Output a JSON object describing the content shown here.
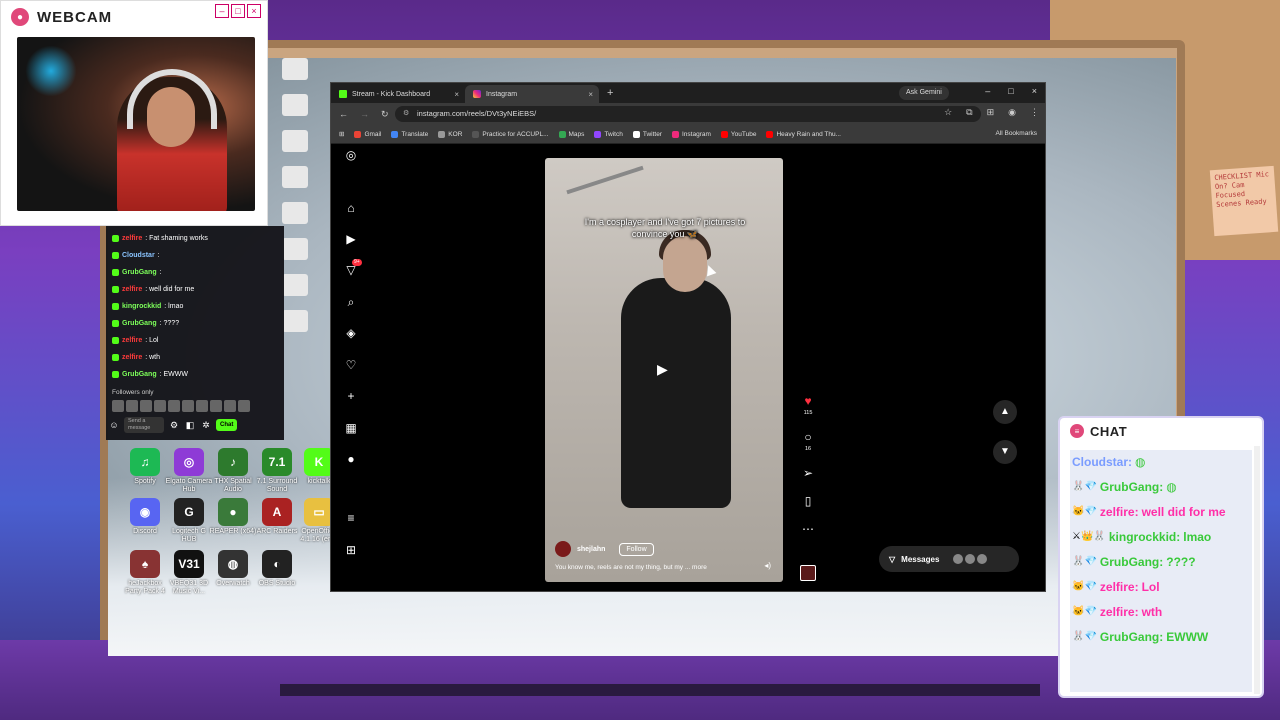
{
  "webcam": {
    "title": "WEBCAM"
  },
  "left_chat": {
    "messages": [
      {
        "user": "zelfire",
        "text": ": Fat shaming works",
        "color": "red"
      },
      {
        "user": "Cloudstar",
        "text": ":",
        "color": "blue"
      },
      {
        "user": "GrubGang",
        "text": ":",
        "color": "green"
      },
      {
        "user": "zelfire",
        "text": ": well did for me",
        "color": "red"
      },
      {
        "user": "kingrockkid",
        "text": ": lmao",
        "color": "green"
      },
      {
        "user": "GrubGang",
        "text": ": ????",
        "color": "green"
      },
      {
        "user": "zelfire",
        "text": ": Lol",
        "color": "red"
      },
      {
        "user": "zelfire",
        "text": ": wth",
        "color": "red"
      },
      {
        "user": "GrubGang",
        "text": ": EWWW",
        "color": "green"
      }
    ],
    "followers_only": "Followers only",
    "send_placeholder": "Send a message",
    "chat_button": "Chat"
  },
  "desktop_icons": [
    {
      "label": "Spotify",
      "color": "#1db954",
      "glyph": "♫"
    },
    {
      "label": "Elgato Camera Hub",
      "color": "#8e3bd6",
      "glyph": "◎"
    },
    {
      "label": "THX Spatial Audio",
      "color": "#2d7a2d",
      "glyph": "♪"
    },
    {
      "label": "7.1 Surround Sound",
      "color": "#2a8a2a",
      "glyph": "7.1"
    },
    {
      "label": "kicktalk",
      "color": "#53fc18",
      "glyph": "K"
    },
    {
      "label": "Discord",
      "color": "#5865f2",
      "glyph": "◉"
    },
    {
      "label": "Logitech G HUB",
      "color": "#222222",
      "glyph": "G"
    },
    {
      "label": "REAPER (x64)",
      "color": "#3a7a3a",
      "glyph": "●"
    },
    {
      "label": "ARC Raiders",
      "color": "#aa2222",
      "glyph": "A"
    },
    {
      "label": "OpenOffice 4.1.16 (en...",
      "color": "#e8c040",
      "glyph": "▭"
    },
    {
      "label": "heJackbox Party Pack 4",
      "color": "#883333",
      "glyph": "♠"
    },
    {
      "label": "VBEQ31 3D Music Vi...",
      "color": "#111111",
      "glyph": "V31"
    },
    {
      "label": "Overwatch",
      "color": "#333333",
      "glyph": "◍"
    },
    {
      "label": "OBS Studio",
      "color": "#222222",
      "glyph": "◐"
    }
  ],
  "browser": {
    "tabs": [
      {
        "label": "Stream - Kick Dashboard",
        "active": false
      },
      {
        "label": "Instagram",
        "active": true
      }
    ],
    "ask_gemini": "Ask Gemini",
    "url": "instagram.com/reels/DVt3yNEiEBS/",
    "bookmarks": [
      {
        "label": "Gmail",
        "color": "#ea4335"
      },
      {
        "label": "Translate",
        "color": "#4285f4"
      },
      {
        "label": "KOR",
        "color": "#999999"
      },
      {
        "label": "Practice for ACCUPL...",
        "color": "#555555"
      },
      {
        "label": "Maps",
        "color": "#34a853"
      },
      {
        "label": "Twitch",
        "color": "#9146ff"
      },
      {
        "label": "Twitter",
        "color": "#ffffff"
      },
      {
        "label": "Instagram",
        "color": "#ee2a7b"
      },
      {
        "label": "YouTube",
        "color": "#ff0000"
      },
      {
        "label": "Heavy Rain and Thu...",
        "color": "#ff0000"
      }
    ],
    "all_bookmarks": "All Bookmarks"
  },
  "reel": {
    "caption": "I'm a cosplayer and I've got 7 pictures to convince you 🦋",
    "username": "shejlahn",
    "follow": "Follow",
    "description": "You know me, reels are not my thing, but my ... more",
    "likes": "115",
    "comments": "16",
    "notification_count": "9+"
  },
  "messages": {
    "label": "Messages",
    "badge": "9+"
  },
  "chat": {
    "title": "CHAT",
    "messages": [
      {
        "user": "Cloudstar:",
        "text": "",
        "ucolor": "b",
        "badges": ""
      },
      {
        "user": "GrubGang:",
        "text": "",
        "ucolor": "g",
        "badges": "🐰💎"
      },
      {
        "user": "zelfire:",
        "text": "well did for me",
        "ucolor": "r",
        "badges": "🐱💎"
      },
      {
        "user": "kingrockkid:",
        "text": "lmao",
        "ucolor": "g",
        "badges": "⚔👑🐰"
      },
      {
        "user": "GrubGang:",
        "text": "????",
        "ucolor": "g",
        "badges": "🐰💎"
      },
      {
        "user": "zelfire:",
        "text": "Lol",
        "ucolor": "r",
        "badges": "🐱💎"
      },
      {
        "user": "zelfire:",
        "text": "wth",
        "ucolor": "r",
        "badges": "🐱💎"
      },
      {
        "user": "GrubGang:",
        "text": "EWWW",
        "ucolor": "g",
        "badges": "🐰💎"
      }
    ]
  },
  "room": {
    "note": "CHECKLIST Mic On? Cam Focused Scenes Ready"
  }
}
